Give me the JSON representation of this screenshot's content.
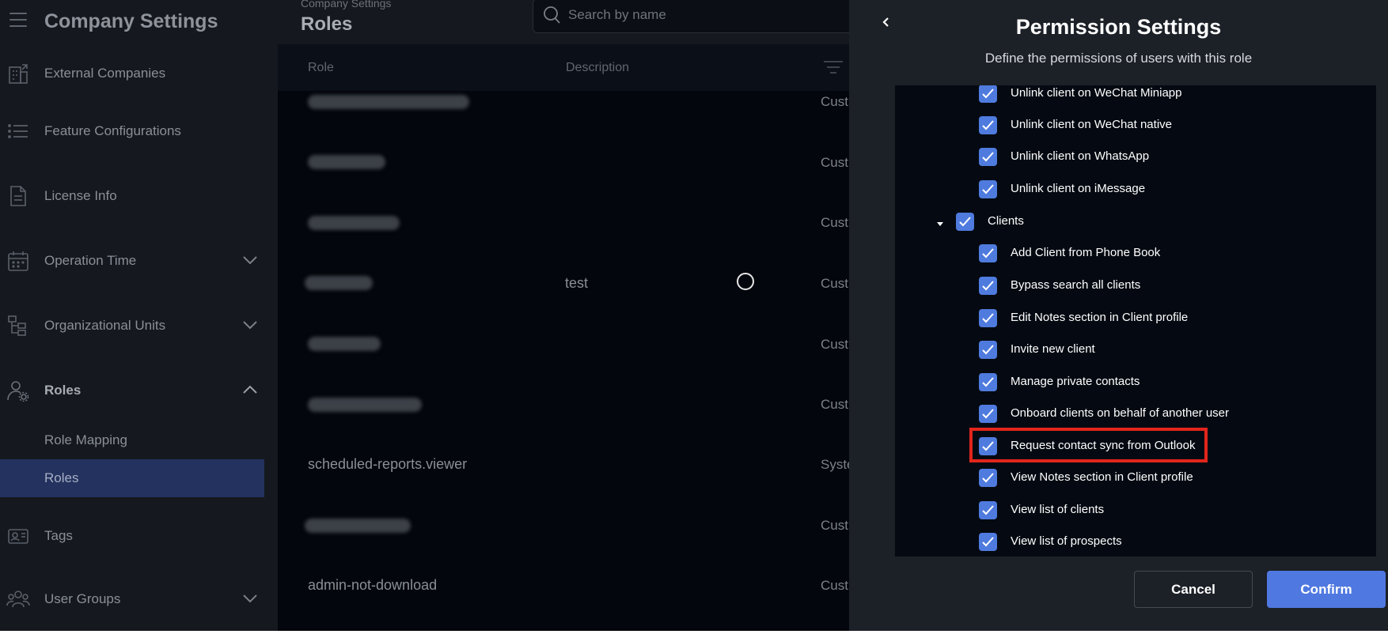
{
  "sidebar": {
    "title": "Company Settings",
    "items": [
      {
        "label": "External Companies"
      },
      {
        "label": "Feature Configurations"
      },
      {
        "label": "License Info"
      },
      {
        "label": "Operation Time"
      },
      {
        "label": "Organizational Units"
      },
      {
        "label": "Roles"
      },
      {
        "label": "Tags"
      },
      {
        "label": "User Groups"
      }
    ],
    "sub_items": [
      {
        "label": "Role Mapping"
      },
      {
        "label": "Roles"
      }
    ]
  },
  "main": {
    "breadcrumb": "Company Settings",
    "title": "Roles",
    "search_placeholder": "Search by name",
    "columns": [
      "Role",
      "Description"
    ],
    "rows": [
      {
        "name": "",
        "description": "",
        "type": "Cust"
      },
      {
        "name": "",
        "description": "",
        "type": "Cust"
      },
      {
        "name": "",
        "description": "",
        "type": "Cust"
      },
      {
        "name": "",
        "description": "test",
        "type": "Cust"
      },
      {
        "name": "",
        "description": "",
        "type": "Cust"
      },
      {
        "name": "",
        "description": "",
        "type": "Cust"
      },
      {
        "name": "scheduled-reports.viewer",
        "description": "",
        "type": "Syste"
      },
      {
        "name": "",
        "description": "",
        "type": "Cust"
      },
      {
        "name": "admin-not-download",
        "description": "",
        "type": "Cust"
      }
    ]
  },
  "panel": {
    "title": "Permission Settings",
    "subtitle": "Define the permissions of users with this role",
    "permissions": [
      {
        "label": "Unlink client on WeChat Miniapp",
        "checked": true
      },
      {
        "label": "Unlink client on WeChat native",
        "checked": true
      },
      {
        "label": "Unlink client on WhatsApp",
        "checked": true
      },
      {
        "label": "Unlink client on iMessage",
        "checked": true
      },
      {
        "label": "Clients",
        "checked": true,
        "group": true,
        "expanded": true
      },
      {
        "label": "Add Client from Phone Book",
        "checked": true
      },
      {
        "label": "Bypass search all clients",
        "checked": true
      },
      {
        "label": "Edit Notes section in Client profile",
        "checked": true
      },
      {
        "label": "Invite new client",
        "checked": true
      },
      {
        "label": "Manage private contacts",
        "checked": true
      },
      {
        "label": "Onboard clients on behalf of another user",
        "checked": true
      },
      {
        "label": "Request contact sync from Outlook",
        "checked": true,
        "highlighted": true
      },
      {
        "label": "View Notes section in Client profile",
        "checked": true
      },
      {
        "label": "View list of clients",
        "checked": true
      },
      {
        "label": "View list of prospects",
        "checked": true
      }
    ],
    "cancel_label": "Cancel",
    "confirm_label": "Confirm"
  },
  "colors": {
    "accent": "#4f7bdf",
    "active_nav": "#24325f",
    "highlight": "#e2251b"
  },
  "icons": {
    "menu": "hamburger-icon",
    "search": "search-icon",
    "back": "chevron-left-icon",
    "check": "check-icon"
  }
}
